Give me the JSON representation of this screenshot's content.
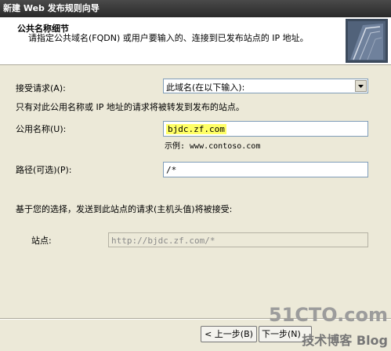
{
  "window": {
    "title": "新建 Web 发布规则向导"
  },
  "header": {
    "title": "公共名称细节",
    "description": "请指定公共域名(FQDN) 或用户要输入的、连接到已发布站点的 IP 地址。"
  },
  "accept": {
    "label": "接受请求(A):",
    "value": "此域名(在以下输入):"
  },
  "info_text": "只有对此公用名称或 IP 地址的请求将被转发到发布的站点。",
  "public_name": {
    "label": "公用名称(U):",
    "value": "bjdc.zf.com",
    "example": "示例: www.contoso.com"
  },
  "path": {
    "label": "路径(可选)(P):",
    "value": "/*"
  },
  "forward_text": "基于您的选择，发送到此站点的请求(主机头值)将被接受:",
  "site": {
    "label": "站点:",
    "value": "http://bjdc.zf.com/*"
  },
  "buttons": {
    "back": "< 上一步(B)",
    "next": "下一步(N)"
  },
  "watermark": {
    "line1": "51CTO.com",
    "line2": "技术博客 Blog"
  }
}
